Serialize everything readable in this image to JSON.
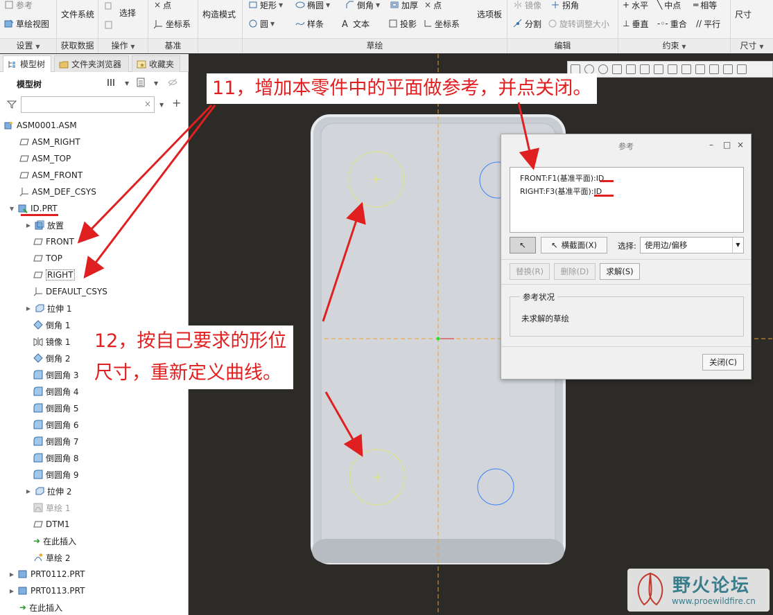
{
  "ribbon": {
    "groups": {
      "setup": {
        "label": "设置",
        "items": [
          "参考",
          "草绘视图"
        ]
      },
      "get_data": {
        "label": "获取数据",
        "items": [
          "文件系统"
        ]
      },
      "operations": {
        "label": "操作",
        "items": [
          "选择"
        ]
      },
      "datum": {
        "label": "基准",
        "items": [
          "点",
          "坐标系"
        ]
      },
      "construct": {
        "items": [
          "构造模式"
        ]
      },
      "sketch": {
        "label": "草绘",
        "items": [
          "矩形",
          "椭圆",
          "倒角",
          "加厚",
          "点",
          "圆",
          "样条",
          "文本",
          "投影",
          "坐标系",
          "选项板"
        ]
      },
      "edit": {
        "label": "编辑",
        "items": [
          "镜像",
          "拐角",
          "分割",
          "旋转调整大小"
        ]
      },
      "constrain": {
        "label": "约束",
        "items": [
          "水平",
          "中点",
          "相等",
          "垂直",
          "重合",
          "平行"
        ]
      },
      "dimension": {
        "label": "尺寸",
        "items": [
          "尺寸"
        ]
      }
    }
  },
  "left_panel": {
    "tabs": [
      "模型树",
      "文件夹浏览器",
      "收藏夹"
    ],
    "tree_title": "模型树",
    "filter_placeholder": "",
    "nodes": [
      "ASM0001.ASM",
      "ASM_RIGHT",
      "ASM_TOP",
      "ASM_FRONT",
      "ASM_DEF_CSYS",
      "ID.PRT",
      "放置",
      "FRONT",
      "TOP",
      "RIGHT",
      "DEFAULT_CSYS",
      "拉伸 1",
      "倒角 1",
      "镜像 1",
      "倒角 2",
      "倒圆角 3",
      "倒圆角 4",
      "倒圆角 5",
      "倒圆角 6",
      "倒圆角 7",
      "倒圆角 8",
      "倒圆角 9",
      "拉伸 2",
      "草绘 1",
      "DTM1",
      "在此插入",
      "草绘 2",
      "PRT0112.PRT",
      "PRT0113.PRT",
      "在此插入"
    ]
  },
  "dialog": {
    "title": "参考",
    "references": [
      "FRONT:F1(基准平面):ID",
      "RIGHT:F3(基准平面):ID"
    ],
    "xsec_button": "横截面(X)",
    "select_label": "选择:",
    "select_value": "使用边/偏移",
    "replace_button": "替换(R)",
    "delete_button": "删除(D)",
    "solve_button": "求解(S)",
    "status_legend": "参考状况",
    "status_value": "未求解的草绘",
    "close_button": "关闭(C)"
  },
  "annotations": {
    "step11": "11，增加本零件中的平面做参考，并点关闭。",
    "step12_line1": "12，按自己要求的形位",
    "step12_line2": "尺寸，重新定义曲线。"
  },
  "watermark": {
    "name": "野火论坛",
    "url": "www.proewildfire.cn"
  },
  "colors": {
    "annotation": "#e02020",
    "canvas": "#2d2b28",
    "sketch_circle": "#e6e66a",
    "blue_circle": "#3b82f6",
    "axis": "#f0a030"
  }
}
